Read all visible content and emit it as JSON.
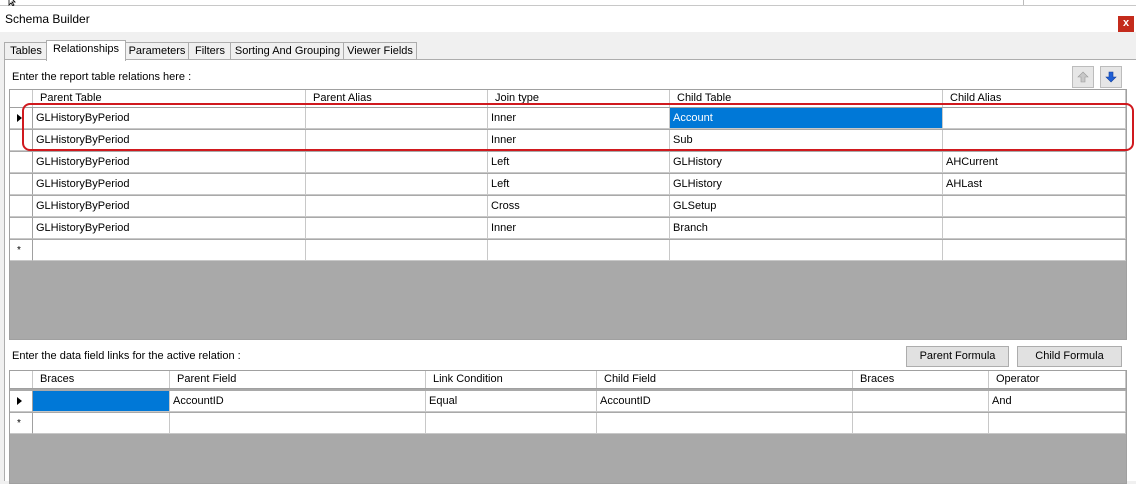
{
  "window": {
    "title": "Schema Builder",
    "close_label": "x"
  },
  "tabs": [
    "Tables",
    "Relationships",
    "Parameters",
    "Filters",
    "Sorting And Grouping",
    "Viewer Fields"
  ],
  "relations": {
    "prompt": "Enter the report table relations here :",
    "columns": [
      "Parent Table",
      "Parent Alias",
      "Join type",
      "Child Table",
      "Child Alias"
    ],
    "rows": [
      [
        "GLHistoryByPeriod",
        "",
        "Inner",
        "Account",
        ""
      ],
      [
        "GLHistoryByPeriod",
        "",
        "Inner",
        "Sub",
        ""
      ],
      [
        "GLHistoryByPeriod",
        "",
        "Left",
        "GLHistory",
        "AHCurrent"
      ],
      [
        "GLHistoryByPeriod",
        "",
        "Left",
        "GLHistory",
        "AHLast"
      ],
      [
        "GLHistoryByPeriod",
        "",
        "Cross",
        "GLSetup",
        ""
      ],
      [
        "GLHistoryByPeriod",
        "",
        "Inner",
        "Branch",
        ""
      ]
    ],
    "new_row_marker": "*"
  },
  "links": {
    "prompt": "Enter the data field links for the active relation :",
    "parent_formula_label": "Parent Formula",
    "child_formula_label": "Child Formula",
    "columns": [
      "Braces",
      "Parent Field",
      "Link Condition",
      "Child Field",
      "Braces",
      "Operator"
    ],
    "rows": [
      [
        "",
        "AccountID",
        "Equal",
        "AccountID",
        "",
        "And"
      ]
    ],
    "new_row_marker": "*"
  },
  "icons": {
    "move_up": "arrow-up-icon",
    "move_down": "arrow-down-icon"
  },
  "colors": {
    "selection": "#0078d7",
    "highlight": "#d0191e",
    "close": "#c42b1c",
    "move_down_arrow": "#1f5fd6"
  }
}
